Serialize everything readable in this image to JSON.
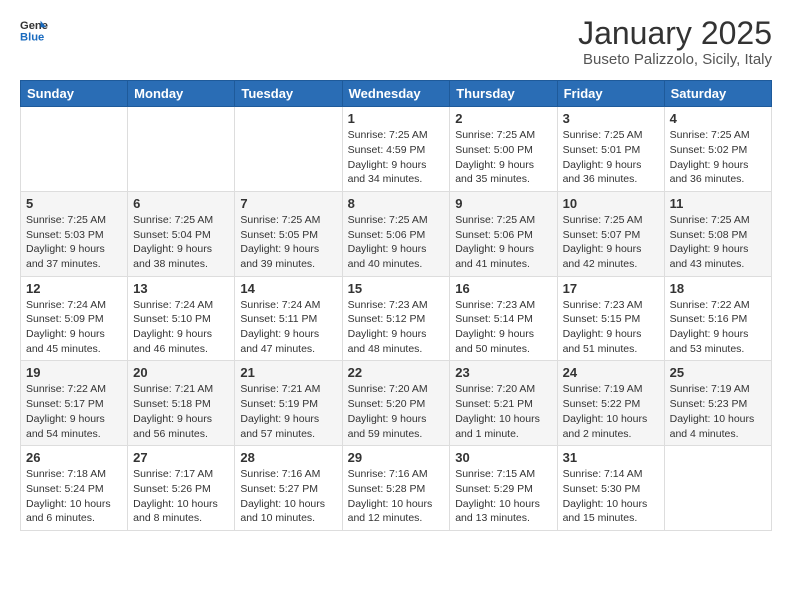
{
  "header": {
    "logo_general": "General",
    "logo_blue": "Blue",
    "title": "January 2025",
    "subtitle": "Buseto Palizzolo, Sicily, Italy"
  },
  "weekdays": [
    "Sunday",
    "Monday",
    "Tuesday",
    "Wednesday",
    "Thursday",
    "Friday",
    "Saturday"
  ],
  "weeks": [
    [
      {
        "day": "",
        "info": ""
      },
      {
        "day": "",
        "info": ""
      },
      {
        "day": "",
        "info": ""
      },
      {
        "day": "1",
        "info": "Sunrise: 7:25 AM\nSunset: 4:59 PM\nDaylight: 9 hours\nand 34 minutes."
      },
      {
        "day": "2",
        "info": "Sunrise: 7:25 AM\nSunset: 5:00 PM\nDaylight: 9 hours\nand 35 minutes."
      },
      {
        "day": "3",
        "info": "Sunrise: 7:25 AM\nSunset: 5:01 PM\nDaylight: 9 hours\nand 36 minutes."
      },
      {
        "day": "4",
        "info": "Sunrise: 7:25 AM\nSunset: 5:02 PM\nDaylight: 9 hours\nand 36 minutes."
      }
    ],
    [
      {
        "day": "5",
        "info": "Sunrise: 7:25 AM\nSunset: 5:03 PM\nDaylight: 9 hours\nand 37 minutes."
      },
      {
        "day": "6",
        "info": "Sunrise: 7:25 AM\nSunset: 5:04 PM\nDaylight: 9 hours\nand 38 minutes."
      },
      {
        "day": "7",
        "info": "Sunrise: 7:25 AM\nSunset: 5:05 PM\nDaylight: 9 hours\nand 39 minutes."
      },
      {
        "day": "8",
        "info": "Sunrise: 7:25 AM\nSunset: 5:06 PM\nDaylight: 9 hours\nand 40 minutes."
      },
      {
        "day": "9",
        "info": "Sunrise: 7:25 AM\nSunset: 5:06 PM\nDaylight: 9 hours\nand 41 minutes."
      },
      {
        "day": "10",
        "info": "Sunrise: 7:25 AM\nSunset: 5:07 PM\nDaylight: 9 hours\nand 42 minutes."
      },
      {
        "day": "11",
        "info": "Sunrise: 7:25 AM\nSunset: 5:08 PM\nDaylight: 9 hours\nand 43 minutes."
      }
    ],
    [
      {
        "day": "12",
        "info": "Sunrise: 7:24 AM\nSunset: 5:09 PM\nDaylight: 9 hours\nand 45 minutes."
      },
      {
        "day": "13",
        "info": "Sunrise: 7:24 AM\nSunset: 5:10 PM\nDaylight: 9 hours\nand 46 minutes."
      },
      {
        "day": "14",
        "info": "Sunrise: 7:24 AM\nSunset: 5:11 PM\nDaylight: 9 hours\nand 47 minutes."
      },
      {
        "day": "15",
        "info": "Sunrise: 7:23 AM\nSunset: 5:12 PM\nDaylight: 9 hours\nand 48 minutes."
      },
      {
        "day": "16",
        "info": "Sunrise: 7:23 AM\nSunset: 5:14 PM\nDaylight: 9 hours\nand 50 minutes."
      },
      {
        "day": "17",
        "info": "Sunrise: 7:23 AM\nSunset: 5:15 PM\nDaylight: 9 hours\nand 51 minutes."
      },
      {
        "day": "18",
        "info": "Sunrise: 7:22 AM\nSunset: 5:16 PM\nDaylight: 9 hours\nand 53 minutes."
      }
    ],
    [
      {
        "day": "19",
        "info": "Sunrise: 7:22 AM\nSunset: 5:17 PM\nDaylight: 9 hours\nand 54 minutes."
      },
      {
        "day": "20",
        "info": "Sunrise: 7:21 AM\nSunset: 5:18 PM\nDaylight: 9 hours\nand 56 minutes."
      },
      {
        "day": "21",
        "info": "Sunrise: 7:21 AM\nSunset: 5:19 PM\nDaylight: 9 hours\nand 57 minutes."
      },
      {
        "day": "22",
        "info": "Sunrise: 7:20 AM\nSunset: 5:20 PM\nDaylight: 9 hours\nand 59 minutes."
      },
      {
        "day": "23",
        "info": "Sunrise: 7:20 AM\nSunset: 5:21 PM\nDaylight: 10 hours\nand 1 minute."
      },
      {
        "day": "24",
        "info": "Sunrise: 7:19 AM\nSunset: 5:22 PM\nDaylight: 10 hours\nand 2 minutes."
      },
      {
        "day": "25",
        "info": "Sunrise: 7:19 AM\nSunset: 5:23 PM\nDaylight: 10 hours\nand 4 minutes."
      }
    ],
    [
      {
        "day": "26",
        "info": "Sunrise: 7:18 AM\nSunset: 5:24 PM\nDaylight: 10 hours\nand 6 minutes."
      },
      {
        "day": "27",
        "info": "Sunrise: 7:17 AM\nSunset: 5:26 PM\nDaylight: 10 hours\nand 8 minutes."
      },
      {
        "day": "28",
        "info": "Sunrise: 7:16 AM\nSunset: 5:27 PM\nDaylight: 10 hours\nand 10 minutes."
      },
      {
        "day": "29",
        "info": "Sunrise: 7:16 AM\nSunset: 5:28 PM\nDaylight: 10 hours\nand 12 minutes."
      },
      {
        "day": "30",
        "info": "Sunrise: 7:15 AM\nSunset: 5:29 PM\nDaylight: 10 hours\nand 13 minutes."
      },
      {
        "day": "31",
        "info": "Sunrise: 7:14 AM\nSunset: 5:30 PM\nDaylight: 10 hours\nand 15 minutes."
      },
      {
        "day": "",
        "info": ""
      }
    ]
  ]
}
